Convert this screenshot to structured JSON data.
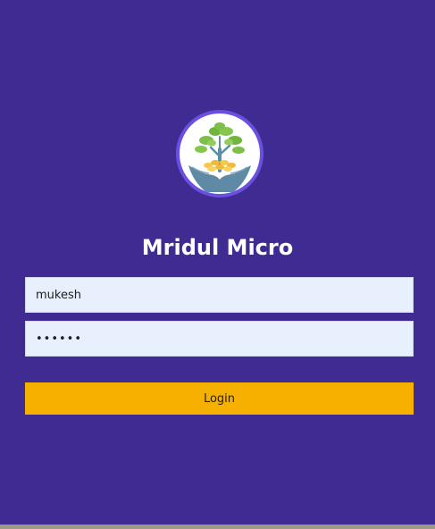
{
  "app": {
    "title": "Mridul Micro"
  },
  "login_form": {
    "username_value": "mukesh",
    "password_value": "mukesh",
    "login_label": "Login"
  },
  "logo": {
    "icon": "tree-in-hands-icon"
  },
  "colors": {
    "background": "#402b93",
    "button": "#f6b100",
    "input_background": "#e8f0fe",
    "logo_ring": "#6a4fe0"
  }
}
